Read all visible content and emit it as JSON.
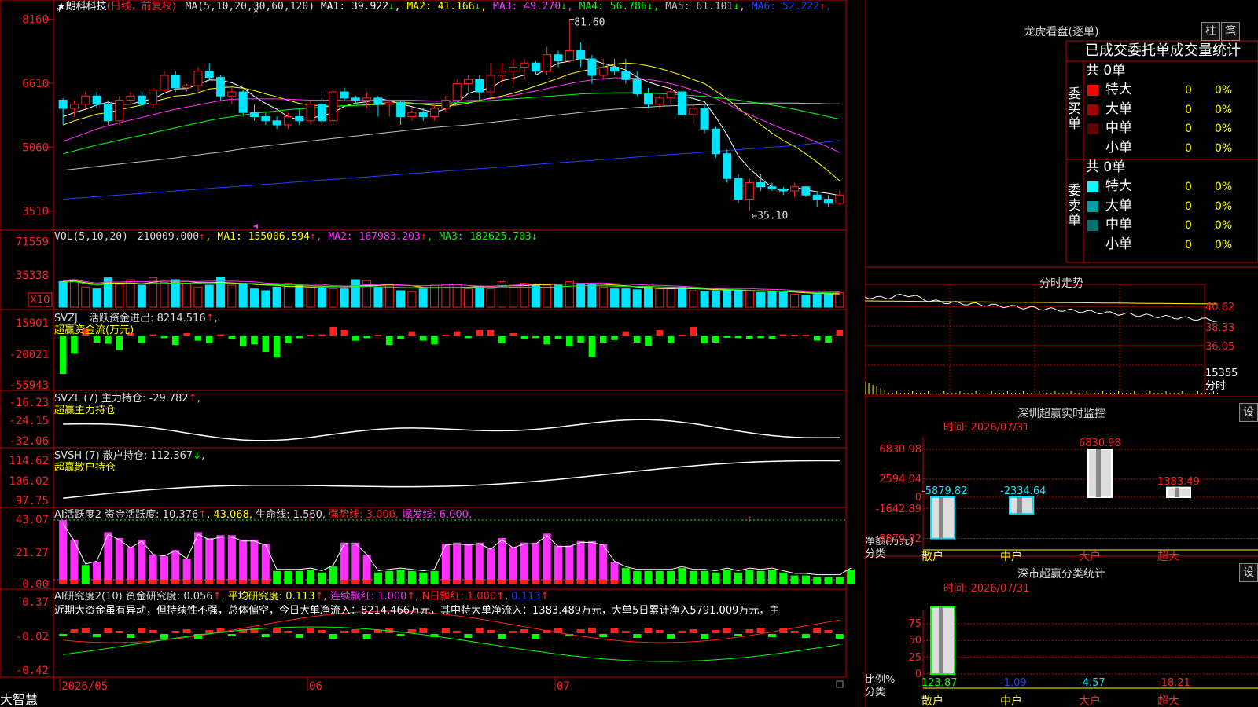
{
  "app": {
    "brand": "大智慧",
    "window_label": "龙虎看盘(逐单)"
  },
  "colors": {
    "up": "#ff2020",
    "down": "#00e5ff",
    "ma1": "#ffffff",
    "ma2": "#ffff00",
    "ma3": "#ff30ff",
    "ma4": "#00ff00",
    "ma5": "#c0c0c0",
    "ma6": "#1e32ff",
    "grid": "#c00000"
  },
  "price_panel": {
    "title_stock": "朗科科技",
    "title_mode": "(日线，前复权)",
    "ma_param": "MA(5,10,20,30,60,120)",
    "ma_values": [
      {
        "label": "MA1:",
        "value": "39.922",
        "arrow": "↓",
        "color": "#ffffff"
      },
      {
        "label": "MA2:",
        "value": "41.166",
        "arrow": "↓",
        "color": "#ffff00"
      },
      {
        "label": "MA3:",
        "value": "49.270",
        "arrow": "↓",
        "color": "#ff30ff"
      },
      {
        "label": "MA4:",
        "value": "56.786",
        "arrow": "↓",
        "color": "#00ff00"
      },
      {
        "label": "MA5:",
        "value": "61.101",
        "arrow": "↓",
        "color": "#c0c0c0"
      },
      {
        "label": "MA6:",
        "value": "52.222",
        "arrow": "↑",
        "color": "#2040ff"
      }
    ],
    "y_labels": [
      "8160",
      "6610",
      "5060",
      "3510"
    ],
    "y_range": [
      32,
      84
    ],
    "high_note": "81.60",
    "low_note": "←35.10"
  },
  "chart_data": {
    "type": "candlestick",
    "x_labels": [
      "2026/05",
      "06",
      "07"
    ],
    "candles": [
      [
        62,
        62.5,
        56,
        60
      ],
      [
        60,
        62,
        58,
        61
      ],
      [
        61,
        64,
        60,
        63
      ],
      [
        63,
        64,
        60,
        61
      ],
      [
        61,
        62,
        56,
        57
      ],
      [
        57,
        63,
        56,
        62
      ],
      [
        62,
        64,
        61,
        63
      ],
      [
        63,
        64,
        60,
        61
      ],
      [
        61,
        65,
        60,
        64.5
      ],
      [
        64.5,
        69,
        64,
        68
      ],
      [
        68,
        69,
        64,
        65
      ],
      [
        65,
        66,
        64,
        65.5
      ],
      [
        65.5,
        70,
        64,
        69
      ],
      [
        69,
        71,
        67,
        67.5
      ],
      [
        67.5,
        68,
        62,
        63
      ],
      [
        63,
        65,
        61,
        64
      ],
      [
        64,
        64.5,
        58,
        59
      ],
      [
        59,
        61,
        57,
        58
      ],
      [
        58,
        59,
        56,
        57
      ],
      [
        57,
        58,
        55,
        56
      ],
      [
        56,
        59,
        55,
        58
      ],
      [
        58,
        60,
        56,
        57
      ],
      [
        57,
        62,
        56,
        61
      ],
      [
        61,
        64,
        56,
        57
      ],
      [
        57,
        64.5,
        56,
        64
      ],
      [
        64,
        65,
        62,
        62.5
      ],
      [
        62.5,
        63,
        61,
        62
      ],
      [
        62,
        64,
        60,
        62.5
      ],
      [
        62.5,
        63,
        58,
        61
      ],
      [
        61,
        62,
        58,
        61.5
      ],
      [
        61.5,
        62,
        56,
        58
      ],
      [
        58,
        60,
        57,
        59
      ],
      [
        59,
        60,
        57,
        58
      ],
      [
        58,
        61,
        57,
        60
      ],
      [
        60,
        63,
        59,
        62
      ],
      [
        62,
        67,
        61,
        66
      ],
      [
        66,
        68,
        64,
        67
      ],
      [
        67,
        68,
        62,
        64
      ],
      [
        64,
        71,
        63,
        68
      ],
      [
        68,
        71,
        66,
        69
      ],
      [
        69,
        72,
        66,
        70
      ],
      [
        70,
        72,
        67,
        71
      ],
      [
        71,
        71.5,
        68,
        69
      ],
      [
        69,
        75,
        68,
        73
      ],
      [
        73,
        74,
        70,
        71.5
      ],
      [
        71.5,
        81.6,
        71,
        74
      ],
      [
        74,
        76,
        70,
        72
      ],
      [
        72,
        73,
        66,
        68
      ],
      [
        68,
        72,
        67,
        70
      ],
      [
        70,
        72,
        68,
        69
      ],
      [
        69,
        72,
        66,
        67
      ],
      [
        67,
        69,
        63,
        63.5
      ],
      [
        63.5,
        65,
        60,
        61
      ],
      [
        61,
        63,
        60,
        62.5
      ],
      [
        62.5,
        66,
        61,
        64
      ],
      [
        64,
        64.5,
        58,
        58.5
      ],
      [
        58.5,
        61,
        56,
        60
      ],
      [
        60,
        61,
        54,
        55
      ],
      [
        55,
        55.5,
        48,
        49
      ],
      [
        49,
        50,
        42,
        43
      ],
      [
        43,
        44,
        37,
        38
      ],
      [
        38,
        43,
        35.1,
        42
      ],
      [
        42,
        44,
        40,
        41
      ],
      [
        41,
        42,
        40,
        40.5
      ],
      [
        40.5,
        41,
        39,
        40
      ],
      [
        40,
        42,
        38.5,
        41
      ],
      [
        41,
        41,
        38.5,
        39
      ],
      [
        39,
        40,
        36,
        38
      ],
      [
        38,
        39,
        36,
        37
      ],
      [
        37,
        40,
        36.5,
        39
      ]
    ],
    "ma": {
      "MA1": {
        "color": "#ffffff",
        "values": [
          58,
          59,
          59.8,
          60.8,
          61.5,
          61,
          61,
          61.8,
          62.3,
          63.7,
          64.7,
          64.8,
          65.8,
          66.9,
          66.8,
          66.2,
          65,
          62.9,
          61.2,
          59.8,
          58,
          57.2,
          57.6,
          58.2,
          59,
          60.5,
          61.3,
          61.6,
          62.4,
          61.9,
          61.1,
          60.4,
          59.7,
          59,
          59.9,
          61.4,
          63.6,
          64.5,
          64.9,
          66.7,
          67.3,
          68.1,
          68.1,
          69.5,
          71,
          71.4,
          72.1,
          71.8,
          70.9,
          70.2,
          69.3,
          67.6,
          66.4,
          65.5,
          64.8,
          63,
          62.4,
          61.6,
          57.9,
          53.6,
          48.5,
          45.4,
          43,
          40.9,
          39.9,
          40.9,
          40.3,
          39.8,
          39.4,
          38.9
        ]
      },
      "MA2": {
        "color": "#ffff00",
        "values": [
          56,
          57,
          57.8,
          58.6,
          59,
          59.7,
          60.2,
          60.8,
          61.6,
          62.3,
          63,
          63.2,
          63.8,
          64.7,
          65,
          65.2,
          64.9,
          64.3,
          63.5,
          62.8,
          62,
          61.2,
          60.8,
          60.6,
          60.5,
          60.6,
          60.7,
          60.9,
          61.2,
          61.4,
          61.5,
          61.3,
          61,
          60.7,
          60.6,
          60.8,
          61.3,
          61.9,
          62.5,
          63,
          63.7,
          64.5,
          65.4,
          66.3,
          67.3,
          68.3,
          69,
          69.5,
          70,
          70.7,
          71,
          70.8,
          70.3,
          69.7,
          68.9,
          68,
          67,
          66,
          64.2,
          62.3,
          60.1,
          58,
          56,
          54,
          52.2,
          50.8,
          49,
          47,
          44.8,
          42.5
        ]
      },
      "MA3": {
        "color": "#ff30ff",
        "values": [
          52,
          53,
          54,
          55,
          55.8,
          56.5,
          57.2,
          57.8,
          58.5,
          59.2,
          59.8,
          60.3,
          60.8,
          61.4,
          61.9,
          62.2,
          62.3,
          62.3,
          62.3,
          62.3,
          62.2,
          62.1,
          62,
          62,
          62,
          61.9,
          61.9,
          61.9,
          62,
          62,
          62,
          62,
          61.9,
          61.8,
          61.8,
          61.8,
          61.9,
          62,
          62.3,
          62.7,
          63.1,
          63.7,
          64.2,
          64.8,
          65.4,
          66,
          66.5,
          66.9,
          67.2,
          67.4,
          67.4,
          67.3,
          67,
          66.6,
          66,
          65.3,
          64.4,
          63.5,
          62.4,
          61.1,
          59.7,
          58.5,
          57.3,
          56.1,
          55,
          54,
          52.9,
          51.8,
          50.6,
          49.3
        ]
      },
      "MA4": {
        "color": "#00ff00",
        "values": [
          49,
          49.7,
          50.4,
          51.1,
          51.7,
          52.3,
          52.9,
          53.5,
          54.1,
          54.7,
          55.3,
          55.9,
          56.5,
          57.1,
          57.6,
          58,
          58.4,
          58.8,
          59.1,
          59.4,
          59.7,
          59.9,
          60.1,
          60.3,
          60.5,
          60.6,
          60.7,
          60.8,
          60.9,
          61,
          61.1,
          61.2,
          61.2,
          61.2,
          61.3,
          61.4,
          61.5,
          61.7,
          61.9,
          62.1,
          62.3,
          62.5,
          62.7,
          62.9,
          63.1,
          63.3,
          63.5,
          63.6,
          63.7,
          63.8,
          63.8,
          63.8,
          63.7,
          63.6,
          63.5,
          63.3,
          63.1,
          62.9,
          62.6,
          62.3,
          62,
          61.6,
          61.2,
          60.8,
          60.3,
          59.8,
          59.2,
          58.6,
          58,
          57.4
        ]
      },
      "MA5": {
        "color": "#c0c0c0",
        "values": [
          45,
          45.3,
          45.6,
          45.9,
          46.2,
          46.5,
          46.8,
          47.1,
          47.4,
          47.7,
          48,
          48.4,
          48.7,
          49.1,
          49.4,
          49.8,
          50.2,
          50.6,
          50.9,
          51.2,
          51.5,
          51.8,
          52.1,
          52.4,
          52.7,
          53,
          53.3,
          53.6,
          53.9,
          54.2,
          54.5,
          54.8,
          55.1,
          55.4,
          55.6,
          55.8,
          56,
          56.3,
          56.6,
          56.9,
          57.2,
          57.5,
          57.8,
          58.1,
          58.4,
          58.7,
          59,
          59.3,
          59.6,
          59.8,
          60,
          60.2,
          60.3,
          60.5,
          60.6,
          60.7,
          60.8,
          60.9,
          61,
          61.1,
          61.2,
          61.3,
          61.3,
          61.3,
          61.3,
          61.3,
          61.2,
          61.2,
          61.1,
          61.1
        ]
      },
      "MA6": {
        "color": "#2040ff",
        "values": [
          38,
          38.2,
          38.4,
          38.6,
          38.8,
          39,
          39.2,
          39.4,
          39.6,
          39.8,
          40,
          40.2,
          40.4,
          40.6,
          40.8,
          41,
          41.2,
          41.4,
          41.6,
          41.8,
          42,
          42.2,
          42.4,
          42.6,
          42.8,
          43,
          43.2,
          43.4,
          43.6,
          43.8,
          44,
          44.2,
          44.4,
          44.6,
          44.8,
          45,
          45.2,
          45.4,
          45.6,
          45.8,
          46,
          46.2,
          46.4,
          46.6,
          46.8,
          47,
          47.2,
          47.4,
          47.6,
          47.8,
          48,
          48.2,
          48.4,
          48.6,
          48.8,
          49,
          49.2,
          49.4,
          49.6,
          49.8,
          50,
          50.2,
          50.4,
          50.6,
          50.8,
          51,
          51.3,
          51.6,
          51.9,
          52.2
        ]
      }
    }
  },
  "vol_panel": {
    "title": "VOL(5,10,20)",
    "value": "210009.000",
    "value_arrow": "↑",
    "mas": [
      {
        "label": "MA1:",
        "value": "155006.594",
        "arrow": "↑",
        "color": "#ffff00"
      },
      {
        "label": "MA2:",
        "value": "167983.203",
        "arrow": "↑",
        "color": "#ff30ff"
      },
      {
        "label": "MA3:",
        "value": "182625.703",
        "arrow": "↓",
        "color": "#00ff00"
      }
    ],
    "y_labels": [
      "71559",
      "35338"
    ],
    "unit_label": "X10",
    "values": [
      28,
      30,
      22,
      20,
      32,
      25,
      30,
      24,
      32,
      27,
      30,
      26,
      22,
      24,
      33,
      24,
      26,
      20,
      18,
      22,
      26,
      24,
      22,
      21,
      20,
      20,
      30,
      29,
      22,
      25,
      18,
      17,
      20,
      24,
      25,
      25,
      20,
      23,
      20,
      28,
      24,
      26,
      25,
      24,
      24,
      28,
      26,
      25,
      22,
      20,
      20,
      19,
      22,
      20,
      20,
      22,
      18,
      17,
      18,
      18,
      18,
      18,
      16,
      17,
      16,
      14,
      13,
      14,
      14,
      16
    ]
  },
  "svzj_panel": {
    "title": "SVZJ",
    "label": "活跃资金进出:",
    "value": "8214.516",
    "arrow": "↑",
    "sub_label": "超赢资金流(万元)",
    "y_labels": [
      "15901",
      "-20021",
      "-55943"
    ],
    "values": [
      -60,
      -28,
      12,
      -10,
      -12,
      -22,
      5,
      -11,
      3,
      -3,
      -14,
      5,
      -7,
      -11,
      3,
      -4,
      -16,
      -13,
      -25,
      -34,
      -11,
      -3,
      0,
      3,
      15,
      10,
      -7,
      -3,
      0,
      -14,
      -5,
      8,
      -7,
      -13,
      2,
      8,
      -3,
      10,
      10,
      -11,
      5,
      -5,
      -3,
      -13,
      -5,
      -16,
      -10,
      -33,
      -10,
      -6,
      8,
      -10,
      -15,
      10,
      -11,
      2,
      15,
      -11,
      -10,
      -2,
      -3,
      -5,
      -3,
      -4,
      3,
      0,
      2,
      -7,
      -10,
      10
    ]
  },
  "svzl_panel": {
    "title": "SVZL (7)",
    "label": "主力持仓:",
    "value": "-29.782",
    "arrow": "↑",
    "sub_label": "超赢主力持仓",
    "y_labels": [
      "-16.23",
      "-24.15",
      "-32.06"
    ],
    "y_range": [
      -32.06,
      -16.23
    ]
  },
  "svsh_panel": {
    "title": "SVSH (7)",
    "label": "散户持仓:",
    "value": "112.367",
    "arrow": "↓",
    "sub_label": "超赢散户持仓",
    "y_labels": [
      "114.62",
      "106.02",
      "97.75"
    ],
    "y_range": [
      97.75,
      114.62
    ]
  },
  "ai1_panel": {
    "title": "AI活跃度2",
    "label": "资金活跃度:",
    "v1": "10.376",
    "a1": "↑",
    "v2": "43.068",
    "label2": "生命线:",
    "v3": "1.560",
    "label3": "强势线:",
    "v4": "3.000",
    "label4": "爆发线:",
    "v5": "6.000",
    "y_labels": [
      "43.07",
      "21.27",
      "0.00"
    ],
    "y_range": [
      0,
      43.07
    ],
    "values": [
      43,
      30,
      13,
      15,
      35,
      31,
      25,
      30,
      20,
      19,
      23,
      17,
      35,
      31,
      33,
      33,
      30,
      30,
      27,
      9,
      9,
      9,
      10,
      8,
      12,
      28,
      28,
      20,
      8,
      9,
      10,
      9,
      8,
      9,
      27,
      28,
      27,
      28,
      24,
      31,
      25,
      28,
      28,
      34,
      26,
      26,
      29,
      29,
      27,
      15,
      11,
      9,
      9,
      9,
      9,
      11,
      9,
      9,
      8,
      10,
      8,
      10,
      9,
      10,
      8,
      6,
      6,
      5,
      5,
      5,
      10
    ]
  },
  "ai2_panel": {
    "title": "AI研究度2(10)",
    "label": "资金研究度:",
    "v1": "0.056",
    "a1": "↑",
    "label2": "平均研究度:",
    "v2": "0.113",
    "a2": "↑",
    "label3": "连续飘红:",
    "v3": "1.000",
    "a3": "↑",
    "label4": "N日飘红:",
    "v4": "1.000",
    "a4": "↑",
    "v5": "0.113",
    "a5": "↑",
    "comment": "近期大资金虽有异动，但持续性不强，总体偏空，今日大单净流入：8214.466万元，其中特大单净流入：1383.489万元，大单5日累计净入5791.009万元，主",
    "y_labels": [
      "0.37",
      "-0.02",
      "-0.42"
    ]
  },
  "right": {
    "title": "龙虎看盘(逐单)",
    "btns": [
      "柱",
      "笔"
    ],
    "section_title": "已成交委托单成交量统计",
    "buy": {
      "side": "委买单",
      "total": "共 0单",
      "rows": [
        {
          "name": "特大",
          "n": "0",
          "p": "0%",
          "color": "#ff0000"
        },
        {
          "name": "大单",
          "n": "0",
          "p": "0%",
          "color": "#a00000"
        },
        {
          "name": "中单",
          "n": "0",
          "p": "0%",
          "color": "#600000"
        },
        {
          "name": "小单",
          "n": "0",
          "p": "0%",
          "color": "none"
        }
      ]
    },
    "sell": {
      "side": "委卖单",
      "total": "共 0单",
      "rows": [
        {
          "name": "特大",
          "n": "0",
          "p": "0%",
          "color": "#00ffff"
        },
        {
          "name": "大单",
          "n": "0",
          "p": "0%",
          "color": "#00a0a0"
        },
        {
          "name": "中单",
          "n": "0",
          "p": "0%",
          "color": "#007070"
        },
        {
          "name": "小单",
          "n": "0",
          "p": "0%",
          "color": "none"
        }
      ]
    },
    "mini": {
      "title": "分时走势",
      "labels": [
        "40.62",
        "38.33",
        "36.05",
        "15355",
        "分时"
      ]
    },
    "sz_monitor": {
      "title": "深圳超赢实时监控",
      "setting": "设",
      "time_label": "时间: 2026/07/31",
      "y_labels": [
        "6830.98",
        "2594.04",
        "0",
        "-1642.89",
        "-5879.82"
      ],
      "axis_title": "净额(万元)",
      "axis_sub": "分类",
      "cats": [
        "散户",
        "中户",
        "大户",
        "超大"
      ],
      "values": [
        -5879.82,
        -2334.64,
        6830.98,
        1383.49
      ],
      "value_labels": [
        "-5879.82",
        "-2334.64",
        "6830.98",
        "1383.49"
      ]
    },
    "sz_class": {
      "title": "深市超赢分类统计",
      "setting": "设",
      "time_label": "时间: 2026/07/31",
      "y_labels": [
        "75",
        "50",
        "25",
        "0"
      ],
      "axis_title": "比例%",
      "axis_sub": "分类",
      "cats": [
        "散户",
        "中户",
        "大户",
        "超大"
      ],
      "values": [
        123.87,
        -1.09,
        -4.57,
        -18.21
      ],
      "value_labels": [
        "123.87",
        "-1.09",
        "-4.57",
        "-18.21"
      ]
    }
  }
}
